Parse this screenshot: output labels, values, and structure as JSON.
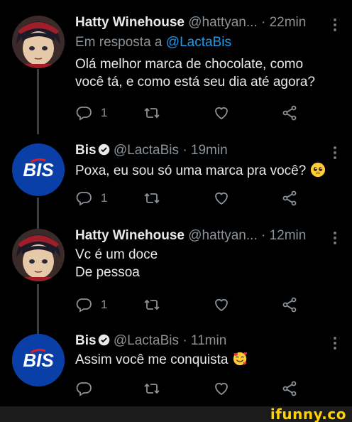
{
  "tweets": [
    {
      "name": "Hatty Winehouse",
      "handle": "@hattyan...",
      "time": "· 22min",
      "reply_prefix": "Em resposta a ",
      "reply_handle": "@LactaBis",
      "lines": [
        "Olá melhor marca de chocolate, como",
        "você tá, e como está seu dia até agora?"
      ],
      "reply_count": "1",
      "avatar": "anime-character-avatar"
    },
    {
      "name": "Bis",
      "handle": "@LactaBis",
      "time": "· 19min",
      "lines": [
        "Poxa, eu sou só uma marca pra você?"
      ],
      "emoji": "pleading-face-emoji",
      "reply_count": "1",
      "avatar": "bis-logo-avatar",
      "avatar_text": "BIS"
    },
    {
      "name": "Hatty Winehouse",
      "handle": "@hattyan...",
      "time": "· 12min",
      "lines": [
        "Vc é um doce",
        "De pessoa"
      ],
      "reply_count": "1",
      "avatar": "anime-character-avatar"
    },
    {
      "name": "Bis",
      "handle": "@LactaBis",
      "time": "· 11min",
      "lines": [
        "Assim você me conquista"
      ],
      "emoji": "smiling-face-with-hearts-emoji",
      "reply_count": "",
      "avatar": "bis-logo-avatar",
      "avatar_text": "BIS"
    }
  ],
  "watermark": "ifunny.co",
  "colors": {
    "background": "#000000",
    "text": "#e7e9ea",
    "secondary": "#8b9298",
    "link": "#1d9bf0",
    "bis_blue": "#0a3fa8",
    "watermark": "#ffd200"
  }
}
